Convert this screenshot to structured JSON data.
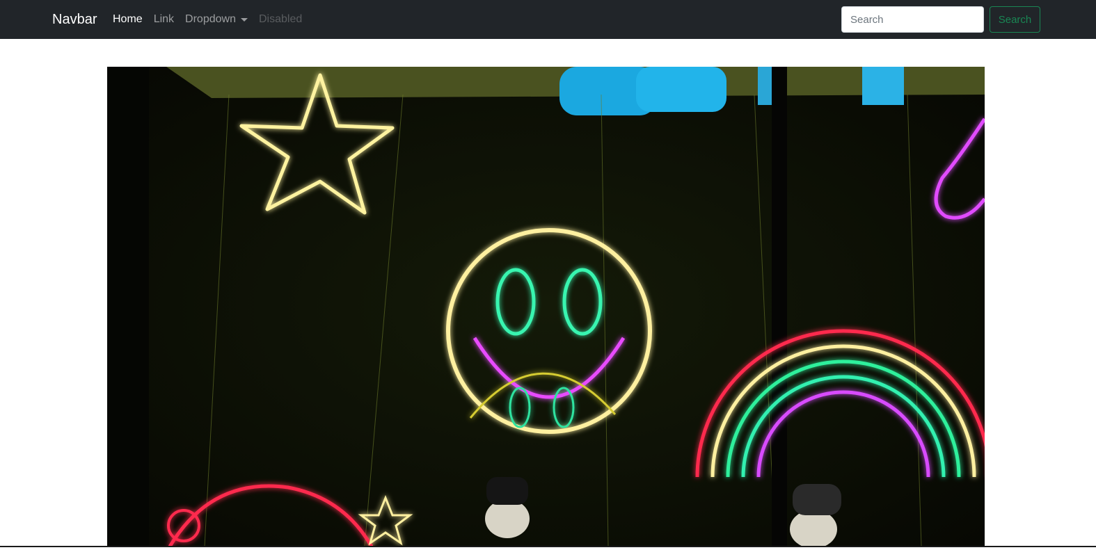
{
  "navbar": {
    "brand": "Navbar",
    "links": {
      "home": "Home",
      "link": "Link",
      "dropdown": "Dropdown",
      "disabled": "Disabled"
    },
    "search": {
      "placeholder": "Search",
      "button_label": "Search"
    },
    "colors": {
      "background": "#212529",
      "search_button": "#198754"
    }
  },
  "hero": {
    "icons": [
      "neon-star-icon",
      "neon-smiley-icon",
      "neon-rainbow-icon",
      "neon-heart-icon"
    ]
  }
}
